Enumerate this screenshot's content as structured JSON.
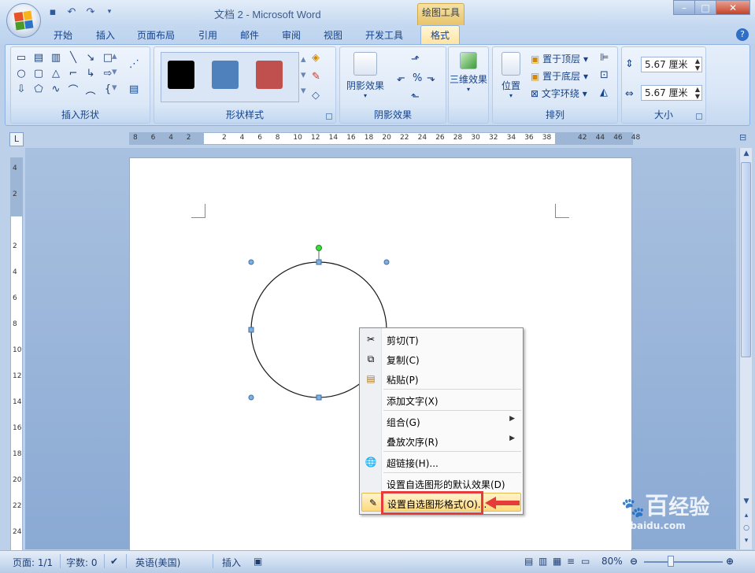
{
  "window": {
    "title": "文档 2 - Microsoft Word",
    "contextual_tab": "绘图工具",
    "buttons": [
      "minimize",
      "maximize",
      "close"
    ]
  },
  "tabs": [
    {
      "label": "开始"
    },
    {
      "label": "插入"
    },
    {
      "label": "页面布局"
    },
    {
      "label": "引用"
    },
    {
      "label": "邮件"
    },
    {
      "label": "审阅"
    },
    {
      "label": "视图"
    },
    {
      "label": "开发工具"
    },
    {
      "label": "格式"
    }
  ],
  "active_tab": "格式",
  "ribbon": {
    "insert_shapes": {
      "label": "插入形状"
    },
    "shape_styles": {
      "label": "形状样式",
      "swatches": [
        "#000000",
        "#4f81bd",
        "#c0504d"
      ]
    },
    "shadow": {
      "label": "阴影效果",
      "button": "阴影效果"
    },
    "three_d": {
      "label": "三维效果",
      "button": "三维效果"
    },
    "arrange": {
      "label": "排列",
      "position": "位置",
      "bring_front": "置于顶层",
      "send_back": "置于底层",
      "text_wrap": "文字环绕"
    },
    "size": {
      "label": "大小",
      "height": "5.67 厘米",
      "width": "5.67 厘米"
    }
  },
  "ruler": {
    "h_numbers": [
      "8",
      "6",
      "4",
      "2",
      "",
      "2",
      "4",
      "6",
      "8",
      "10",
      "12",
      "14",
      "16",
      "18",
      "20",
      "22",
      "24",
      "26",
      "28",
      "30",
      "32",
      "34",
      "36",
      "38",
      "",
      "42",
      "44",
      "46",
      "48"
    ],
    "v_numbers": [
      "4",
      "2",
      "",
      "2",
      "4",
      "6",
      "8",
      "10",
      "12",
      "14",
      "16",
      "18",
      "20",
      "22",
      "24"
    ]
  },
  "context_menu": {
    "items": [
      {
        "label": "剪切(T)",
        "icon": "scissors-icon"
      },
      {
        "label": "复制(C)",
        "icon": "copy-icon"
      },
      {
        "label": "粘贴(P)",
        "icon": "paste-icon"
      },
      {
        "label": "添加文字(X)",
        "icon": ""
      },
      {
        "label": "组合(G)",
        "icon": "",
        "submenu": true
      },
      {
        "label": "叠放次序(R)",
        "icon": "",
        "submenu": true
      },
      {
        "label": "超链接(H)...",
        "icon": "hyperlink-icon"
      },
      {
        "label": "设置自选图形的默认效果(D)",
        "icon": ""
      },
      {
        "label": "设置自选图形格式(O)...",
        "icon": "format-shape-icon",
        "highlighted": true
      }
    ]
  },
  "status_bar": {
    "page": "页面: 1/1",
    "words": "字数: 0",
    "language": "英语(美国)",
    "mode": "插入",
    "zoom": "80%"
  },
  "watermark": {
    "brand": "Bai",
    "brand2": "百",
    "brand3": "经验",
    "url": "jingyan.baidu.com"
  },
  "colors": {
    "accent": "#15428b",
    "highlight": "#ffd97c",
    "callout": "#e53b3b"
  }
}
